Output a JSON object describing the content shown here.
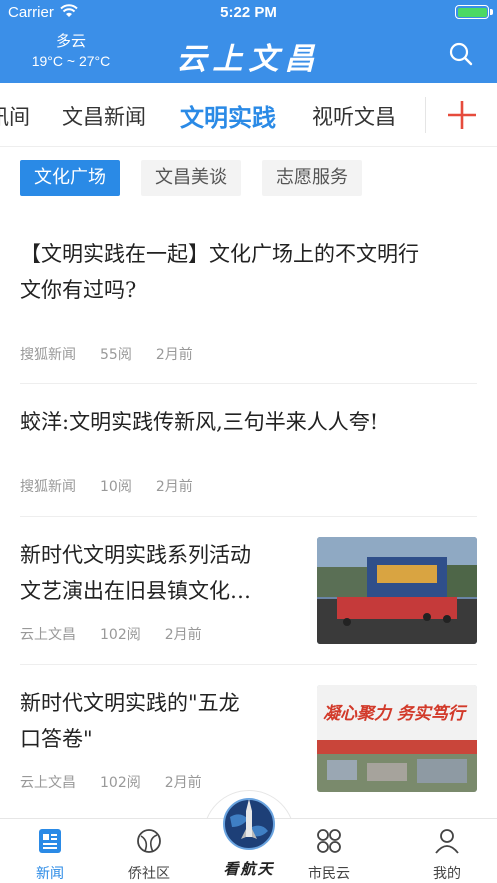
{
  "status": {
    "carrier": "Carrier",
    "time": "5:22 PM"
  },
  "header": {
    "weather_condition": "多云",
    "weather_temp": "19°C ~ 27°C",
    "brand": "云上文昌",
    "search_icon": "search-icon"
  },
  "tabs": {
    "items": [
      {
        "label": "讯间"
      },
      {
        "label": "文昌新闻"
      },
      {
        "label": "文明实践",
        "active": true
      },
      {
        "label": "视听文昌"
      }
    ],
    "add_icon": "plus-icon",
    "add_color": "#e64b3c"
  },
  "subtabs": {
    "items": [
      {
        "label": "文化广场",
        "active": true
      },
      {
        "label": "文昌美谈"
      },
      {
        "label": "志愿服务"
      }
    ]
  },
  "articles": [
    {
      "title": "【文明实践在一起】文化广场上的不文明行为你有过吗?",
      "title_l1": "【文明实践在一起】文化广场上的不文明行",
      "title_l2": "文你有过吗?",
      "source": "搜狐新闻",
      "reads": "55阅",
      "time": "2月前"
    },
    {
      "title": "蛟洋:文明实践传新风,三句半来人人夸!",
      "source": "搜狐新闻",
      "reads": "10阅",
      "time": "2月前"
    },
    {
      "title_l1": "新时代文明实践系列活动",
      "title_l2": "文艺演出在旧县镇文化…",
      "source": "云上文昌",
      "reads": "102阅",
      "time": "2月前",
      "image": "stage-performance-photo"
    },
    {
      "title_l1": "新时代文明实践的\"五龙",
      "title_l2": "口答卷\"",
      "source": "云上文昌",
      "reads": "102阅",
      "time": "2月前",
      "image": "banner-photo",
      "banner_text": "凝心聚力 务实笃行"
    }
  ],
  "bottomnav": {
    "items": [
      {
        "label": "新闻",
        "icon": "news-icon",
        "active": true
      },
      {
        "label": "侨社区",
        "icon": "community-icon"
      },
      {
        "label": "看航天",
        "icon": "globe-rocket-icon"
      },
      {
        "label": "市民云",
        "icon": "grid-icon"
      },
      {
        "label": "我的",
        "icon": "user-icon"
      }
    ]
  },
  "colors": {
    "header_bg": "#3b8fe8",
    "accent": "#2a8ae6"
  }
}
